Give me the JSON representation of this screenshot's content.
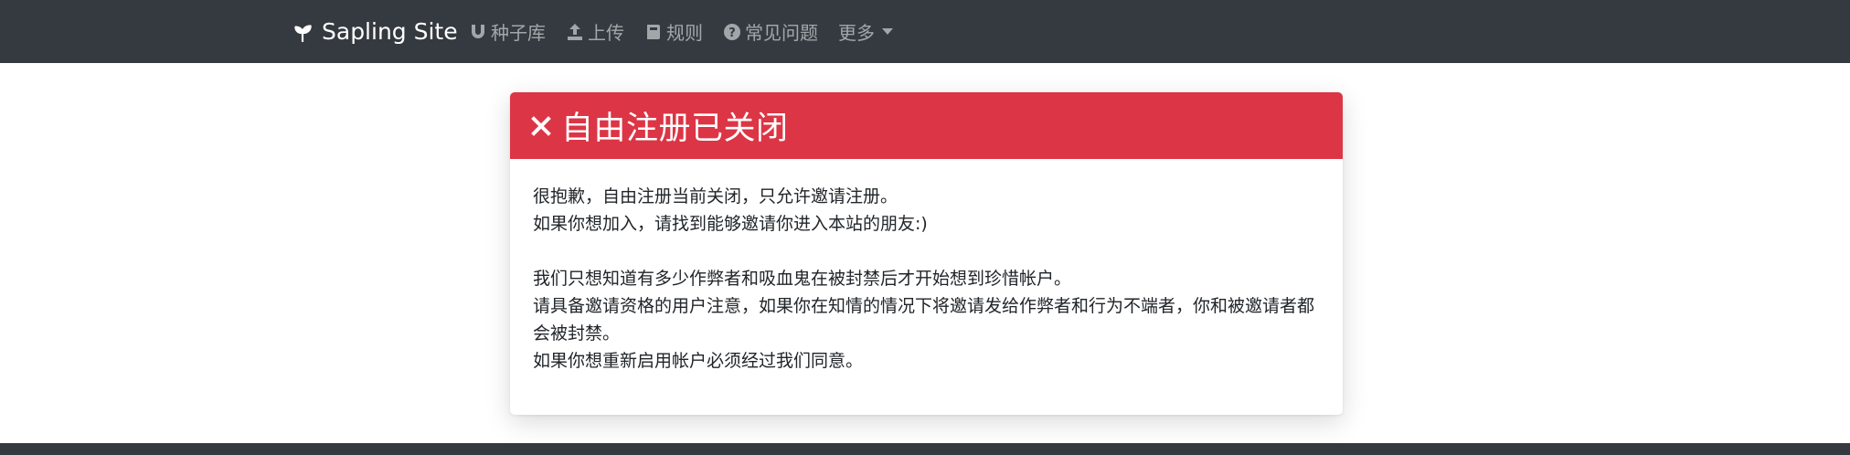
{
  "navbar": {
    "brand": "Sapling Site",
    "items": [
      {
        "label": "种子库",
        "icon": "magnet-icon"
      },
      {
        "label": "上传",
        "icon": "upload-icon"
      },
      {
        "label": "规则",
        "icon": "book-icon"
      },
      {
        "label": "常见问题",
        "icon": "question-circle-icon"
      }
    ],
    "more": "更多"
  },
  "alert": {
    "title": "自由注册已关闭",
    "lines": [
      "很抱歉，自由注册当前关闭，只允许邀请注册。",
      "如果你想加入，请找到能够邀请你进入本站的朋友:)",
      "我们只想知道有多少作弊者和吸血鬼在被封禁后才开始想到珍惜帐户。",
      "请具备邀请资格的用户注意，如果你在知情的情况下将邀请发给作弊者和行为不端者，你和被邀请者都会被封禁。",
      "如果你想重新启用帐户必须经过我们同意。"
    ]
  },
  "colors": {
    "navbar": "#343a40",
    "header": "#dc3545"
  }
}
